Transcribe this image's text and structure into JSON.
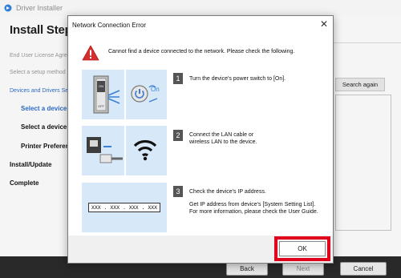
{
  "window": {
    "title": "Driver Installer"
  },
  "sidebar": {
    "heading": "Install Steps",
    "items": [
      {
        "label": "End User License Agree"
      },
      {
        "label": "Select a setup method"
      },
      {
        "label": "Devices and Drivers Se"
      },
      {
        "label": "Select a device"
      },
      {
        "label": "Select a device d"
      },
      {
        "label": "Printer Preferen"
      },
      {
        "label": "Install/Update"
      },
      {
        "label": "Complete"
      }
    ]
  },
  "background": {
    "search_again": "Search again"
  },
  "footer": {
    "back": "Back",
    "next": "Next",
    "cancel": "Cancel"
  },
  "dialog": {
    "title": "Network Connection Error",
    "message": "Cannot find a device connected to the network. Please check the following.",
    "steps": [
      {
        "number": "1",
        "lines": [
          "Turn the device's power switch to [On]."
        ],
        "panel_labels": [
          "On"
        ]
      },
      {
        "number": "2",
        "lines": [
          "Connect the LAN cable or",
          "wireless LAN to the device."
        ]
      },
      {
        "number": "3",
        "lines": [
          "Check the device's IP address.",
          "Get IP address from device's [System Setting List].",
          "For more information, please check the User Guide."
        ],
        "ip_placeholder": "XXX . XXX . XXX . XXX"
      }
    ],
    "ok": "OK"
  },
  "colors": {
    "panel": "#d7e9f8",
    "icon_blue": "#3a7fd5",
    "highlight": "#e0001b",
    "warning": "#d32f2f",
    "footer_bar": "#2b2b2b"
  },
  "icons": [
    "app-icon",
    "close-icon",
    "warning-icon",
    "power-switch-icon",
    "power-button-icon",
    "lan-cable-icon",
    "wifi-icon"
  ]
}
